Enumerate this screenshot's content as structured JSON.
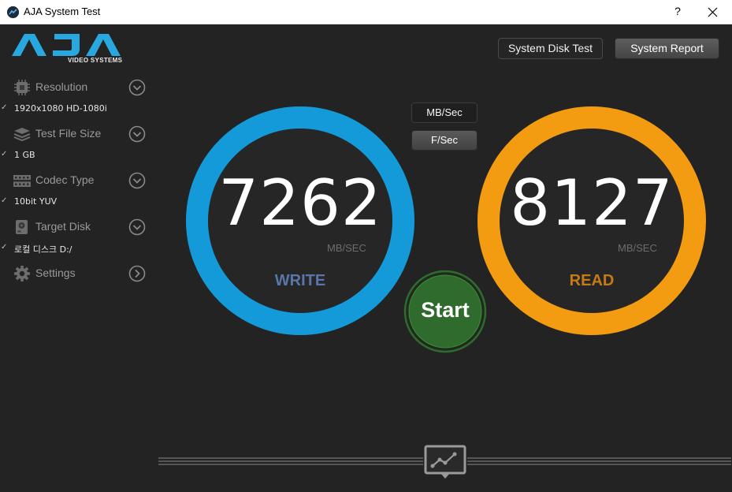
{
  "window": {
    "title": "AJA System Test",
    "help_label": "?"
  },
  "logo": {
    "name": "AJA",
    "subtitle": "VIDEO SYSTEMS"
  },
  "sidebar": {
    "items": [
      {
        "label": "Resolution",
        "value": "1920x1080 HD-1080i"
      },
      {
        "label": "Test File Size",
        "value": "1 GB"
      },
      {
        "label": "Codec Type",
        "value": "10bit YUV"
      },
      {
        "label": "Target Disk",
        "value": "로컬 디스크 D:/"
      },
      {
        "label": "Settings"
      }
    ],
    "check_mark": "✓"
  },
  "toolbar": {
    "system_disk_test": "System Disk Test",
    "system_report": "System Report"
  },
  "units": {
    "mb_sec": "MB/Sec",
    "f_sec": "F/Sec"
  },
  "write": {
    "value": "7262",
    "unit": "MB/SEC",
    "label": "WRITE",
    "color": "#149ad9",
    "label_color": "#5a76a8"
  },
  "read": {
    "value": "8127",
    "unit": "MB/SEC",
    "label": "READ",
    "color": "#f39c12",
    "label_color": "#c47a17"
  },
  "start": {
    "label": "Start",
    "color": "#2f6b2c"
  },
  "colors": {
    "background": "#232323",
    "sidebar_label": "#9a9a9a"
  }
}
